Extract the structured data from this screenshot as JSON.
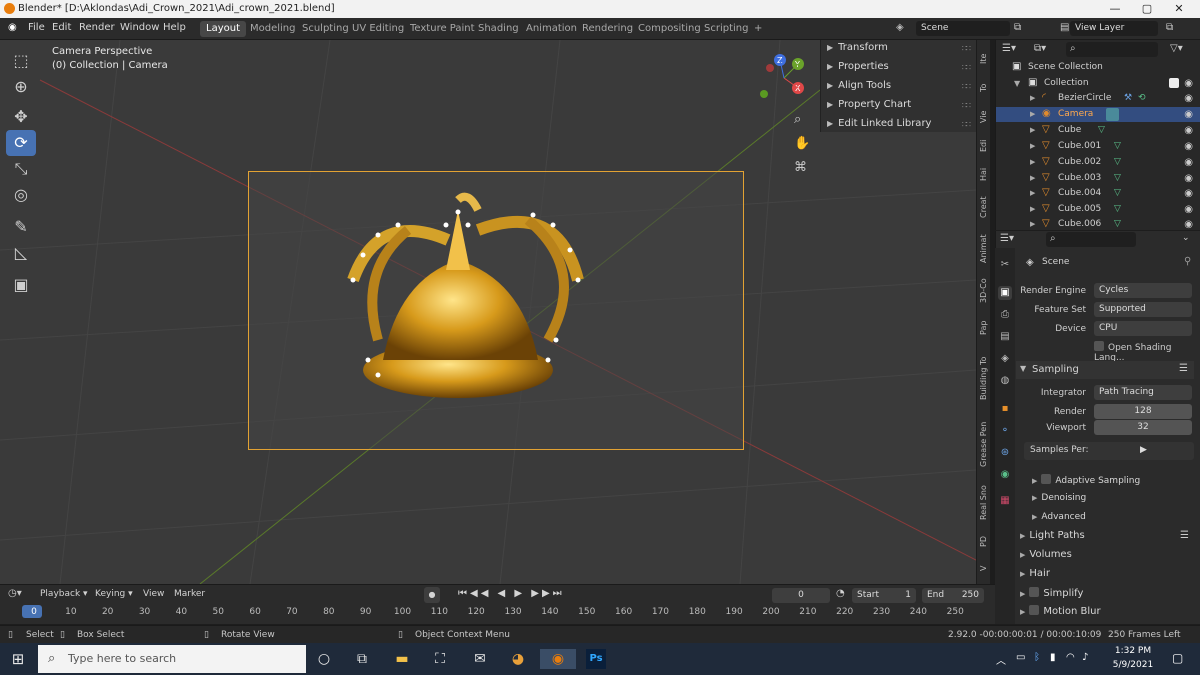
{
  "window": {
    "title": "Blender* [D:\\Aklondas\\Adi_Crown_2021\\Adi_crown_2021.blend]"
  },
  "menu": [
    "File",
    "Edit",
    "Render",
    "Window",
    "Help"
  ],
  "workspaces": [
    "Layout",
    "Modeling",
    "Sculpting",
    "UV Editing",
    "Texture Paint",
    "Shading",
    "Animation",
    "Rendering",
    "Compositing",
    "Scripting",
    "+"
  ],
  "scene_field": "Scene",
  "view_layer_field": "View Layer",
  "viewport": {
    "line1": "Camera Perspective",
    "line2": "(0) Collection | Camera"
  },
  "sidebar_panel": [
    "Transform",
    "Properties",
    "Align Tools",
    "Property Chart",
    "Edit Linked Library"
  ],
  "vertical_tabs": [
    "Ite",
    "To",
    "Vie",
    "Edi",
    "Hai",
    "Creat",
    "Animat",
    "3D-Co",
    "Pap",
    "Building To",
    "Grease Pen",
    "Real Sno",
    "PD",
    "V"
  ],
  "outliner": {
    "root": "Scene Collection",
    "collection": "Collection",
    "items": [
      "BezierCircle",
      "Camera",
      "Cube",
      "Cube.001",
      "Cube.002",
      "Cube.003",
      "Cube.004",
      "Cube.005",
      "Cube.006"
    ]
  },
  "props": {
    "scene": "Scene",
    "render_engine_label": "Render Engine",
    "render_engine": "Cycles",
    "feature_set_label": "Feature Set",
    "feature_set": "Supported",
    "device_label": "Device",
    "device": "CPU",
    "osl": "Open Shading Lang...",
    "sampling": "Sampling",
    "integrator_label": "Integrator",
    "integrator": "Path Tracing",
    "render_label": "Render",
    "render": "128",
    "viewport_label": "Viewport",
    "viewport": "32",
    "samples_per": "Samples Per:",
    "adaptive": "Adaptive Sampling",
    "denoising": "Denoising",
    "advanced": "Advanced",
    "light_paths": "Light Paths",
    "volumes": "Volumes",
    "hair": "Hair",
    "simplify": "Simplify",
    "motion_blur": "Motion Blur"
  },
  "timeline": {
    "menus": [
      "Playback",
      "Keying",
      "View",
      "Marker"
    ],
    "current": "0",
    "start_label": "Start",
    "start": "1",
    "end_label": "End",
    "end": "250",
    "ticks": [
      "0",
      "10",
      "20",
      "30",
      "40",
      "50",
      "60",
      "70",
      "80",
      "90",
      "100",
      "110",
      "120",
      "130",
      "140",
      "150",
      "160",
      "170",
      "180",
      "190",
      "200",
      "210",
      "220",
      "230",
      "240",
      "250"
    ]
  },
  "status": {
    "select": "Select",
    "box_select": "Box Select",
    "rotate": "Rotate View",
    "context_menu": "Object Context Menu",
    "info": "2.92.0 -00:00:00:01 / 00:00:10:09",
    "frames_left": "250 Frames Left"
  },
  "taskbar": {
    "search_placeholder": "Type here to search",
    "time": "1:32 PM",
    "date": "5/9/2021"
  }
}
